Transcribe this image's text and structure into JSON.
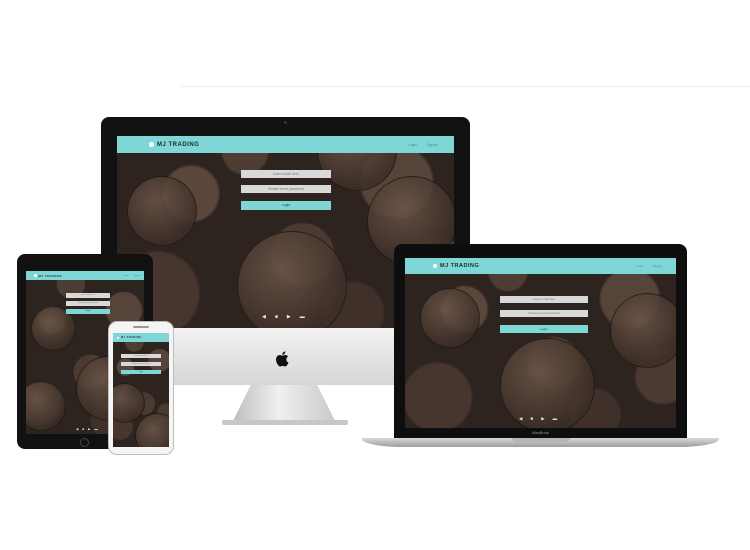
{
  "site": {
    "brand": "MJ TRADING",
    "nav": [
      "Login",
      "Signup"
    ],
    "fields": [
      "Insert email here",
      "Please insert password"
    ],
    "button": "Login",
    "social": [
      "◀",
      "■",
      "▶",
      "▬"
    ]
  },
  "macbook": {
    "label": "MacBook"
  },
  "colors": {
    "accent": "#7fd6d6",
    "background": "#2d241f"
  }
}
